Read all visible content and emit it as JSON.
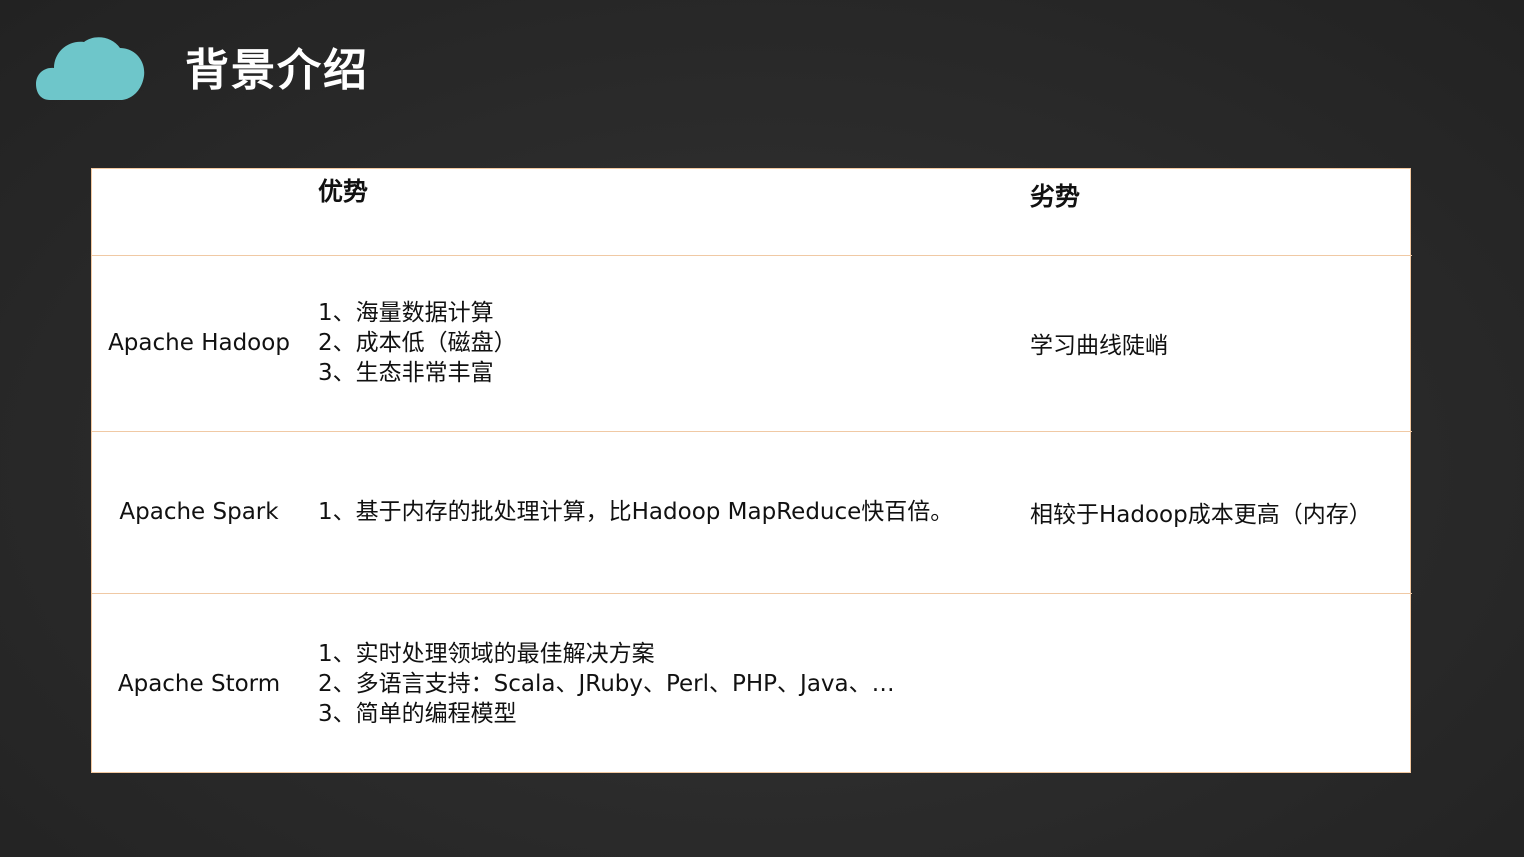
{
  "header": {
    "title": "背景介绍",
    "icon": "cloud-icon",
    "icon_color": "#6ec6ca"
  },
  "table": {
    "columns": [
      "",
      "优势",
      "劣势"
    ],
    "rows": [
      {
        "name": "Apache Hadoop",
        "advantages": [
          "1、海量数据计算",
          "2、成本低（磁盘）",
          "3、生态非常丰富"
        ],
        "disadvantages": "学习曲线陡峭"
      },
      {
        "name": "Apache Spark",
        "advantages": [
          "1、基于内存的批处理计算，比Hadoop MapReduce快百倍。"
        ],
        "disadvantages": "相较于Hadoop成本更高（内存）"
      },
      {
        "name": "Apache Storm",
        "advantages": [
          "1、实时处理领域的最佳解决方案",
          "2、多语言支持：Scala、JRuby、Perl、PHP、Java、…",
          "3、简单的编程模型"
        ],
        "disadvantages": ""
      }
    ]
  },
  "colors": {
    "table_border": "#f2c8a0",
    "text": "#111111",
    "title": "#ffffff"
  }
}
